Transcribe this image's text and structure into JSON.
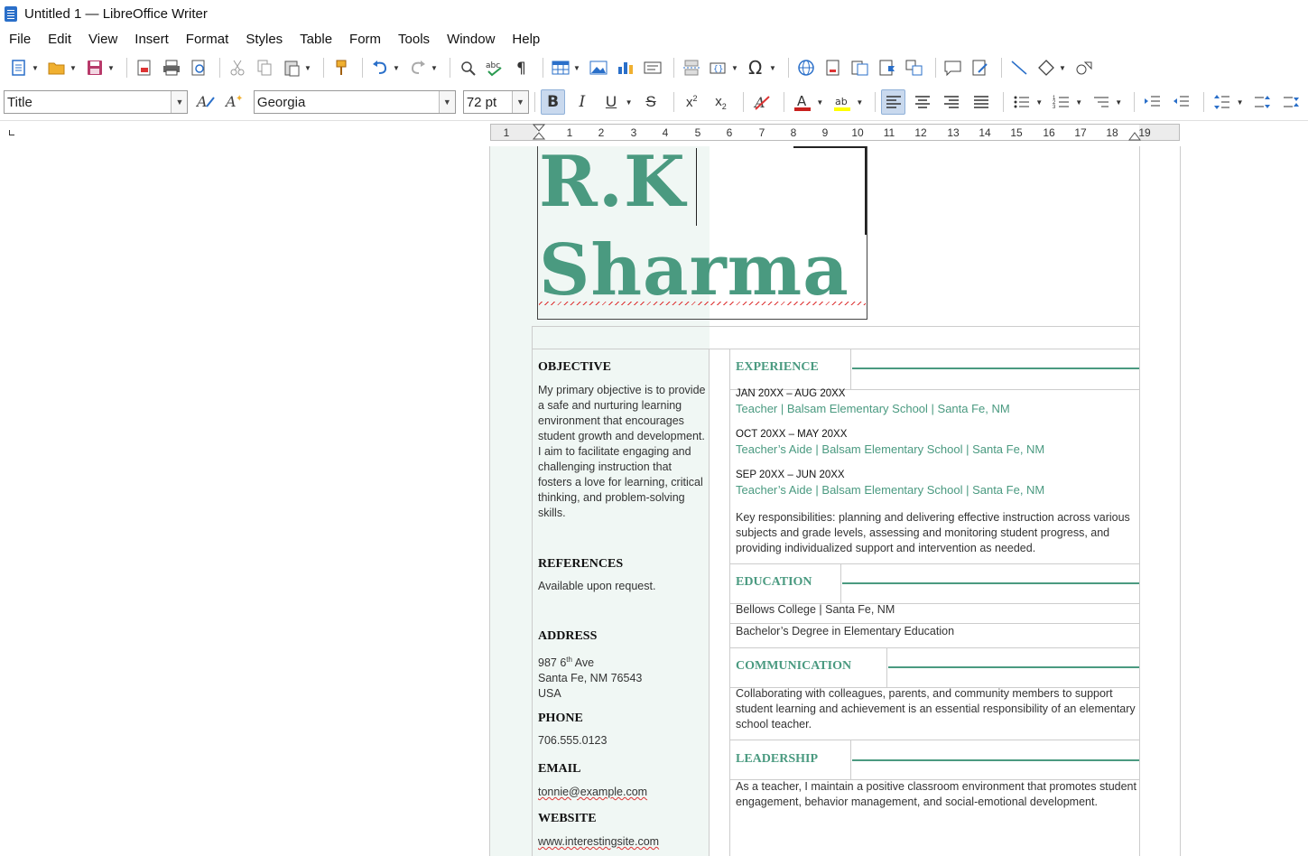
{
  "window": {
    "title": "Untitled 1 — LibreOffice Writer"
  },
  "menu": {
    "items": [
      {
        "label": "File"
      },
      {
        "label": "Edit"
      },
      {
        "label": "View"
      },
      {
        "label": "Insert"
      },
      {
        "label": "Format"
      },
      {
        "label": "Styles"
      },
      {
        "label": "Table"
      },
      {
        "label": "Form"
      },
      {
        "label": "Tools"
      },
      {
        "label": "Window"
      },
      {
        "label": "Help"
      }
    ]
  },
  "formatting": {
    "paragraph_style": "Title",
    "font_name": "Georgia",
    "font_size": "72 pt",
    "bold_active": true,
    "align_left_active": true
  },
  "ruler": {
    "numbers": [
      "1",
      "1",
      "2",
      "3",
      "4",
      "5",
      "6",
      "7",
      "8",
      "9",
      "10",
      "11",
      "12",
      "13",
      "14",
      "15",
      "16",
      "17",
      "18",
      "19"
    ]
  },
  "document": {
    "name_line1": "R.K",
    "name_line2": "Sharma",
    "left": {
      "objective_head": "OBJECTIVE",
      "objective_text": "My primary objective is to provide a safe and nurturing learning environment that encourages student growth and development. I aim to facilitate engaging and challenging instruction that fosters a love for learning, critical thinking, and problem-solving skills.",
      "references_head": "REFERENCES",
      "references_text": "Available upon request.",
      "address_head": "ADDRESS",
      "address_line1_pre": "987 6",
      "address_line1_sup": "th",
      "address_line1_post": " Ave",
      "address_line2": "Santa Fe, NM 76543",
      "address_line3": "USA",
      "phone_head": "PHONE",
      "phone_text": "706.555.0123",
      "email_head": "EMAIL",
      "email_text": "tonnie@example.com",
      "website_head": "WEBSITE",
      "website_text": "www.interestingsite.com"
    },
    "right": {
      "experience_head": "EXPERIENCE",
      "jobs": [
        {
          "date": "JAN 20XX – AUG 20XX",
          "title": "Teacher | Balsam Elementary School | Santa Fe, NM"
        },
        {
          "date": "OCT 20XX – MAY 20XX",
          "title": "Teacher’s Aide | Balsam Elementary School | Santa Fe, NM"
        },
        {
          "date": "SEP 20XX – JUN 20XX",
          "title": "Teacher’s Aide | Balsam Elementary School | Santa Fe, NM"
        }
      ],
      "responsibilities": "Key responsibilities: planning and delivering effective instruction across various subjects and grade levels, assessing and monitoring student progress, and providing individualized support and intervention as needed.",
      "education_head": "EDUCATION",
      "education_line1": "Bellows College | Santa Fe, NM",
      "education_line2": "Bachelor’s Degree in Elementary Education",
      "communication_head": "COMMUNICATION",
      "communication_text": "Collaborating with colleagues, parents, and community members to support student learning and achievement is an essential responsibility of an elementary school teacher.",
      "leadership_head": "LEADERSHIP",
      "leadership_text": "As a teacher, I maintain a positive classroom environment that promotes student engagement, behavior management, and social-emotional development."
    }
  }
}
